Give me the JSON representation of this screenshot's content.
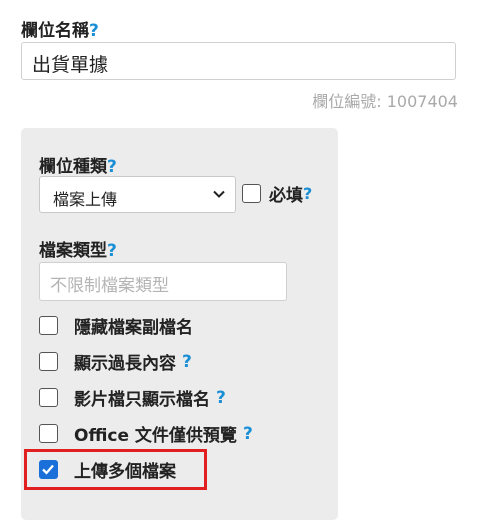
{
  "field_name": {
    "label": "欄位名稱",
    "help": "?",
    "value": "出貨單據",
    "field_id": "欄位編號: 1007404"
  },
  "settings": {
    "type_label": "欄位種類",
    "type_help": "?",
    "type_value": "檔案上傳",
    "required_label": "必填",
    "required_help": "?",
    "required_checked": false,
    "filetype_label": "檔案類型",
    "filetype_help": "?",
    "filetype_placeholder": "不限制檔案類型",
    "options": [
      {
        "label": "隱藏檔案副檔名",
        "help": "",
        "checked": false
      },
      {
        "label": "顯示過長內容",
        "help": "?",
        "checked": false
      },
      {
        "label": "影片檔只顯示檔名",
        "help": "?",
        "checked": false
      },
      {
        "label": "Office 文件僅供預覽",
        "help": "?",
        "checked": false
      },
      {
        "label": "上傳多個檔案",
        "help": "",
        "checked": true
      }
    ]
  },
  "colors": {
    "help_icon": "#1a8fd6",
    "checkbox_checked": "#1a6fd9",
    "highlight_border": "#e02020",
    "panel_bg": "#ececec"
  }
}
